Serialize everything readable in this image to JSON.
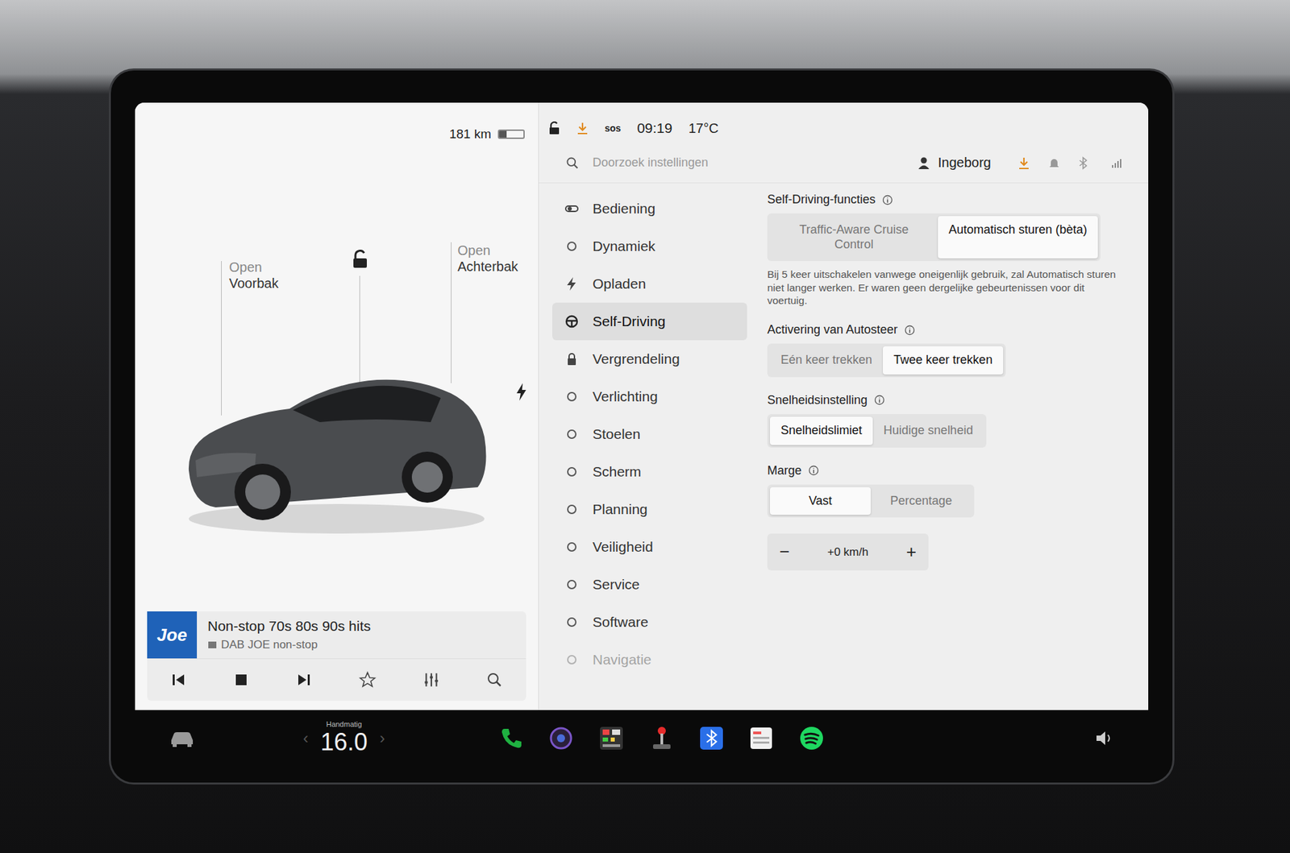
{
  "status": {
    "range": "181 km",
    "battery_level": 0.3,
    "locked": false,
    "sos": "sos",
    "time": "09:19",
    "temperature": "17°C"
  },
  "car": {
    "locked": false,
    "charging": true,
    "front_trunk": {
      "action": "Open",
      "name": "Voorbak"
    },
    "rear_trunk": {
      "action": "Open",
      "name": "Achterbak"
    }
  },
  "media": {
    "logo": "Joe",
    "title": "Non-stop 70s 80s 90s hits",
    "subtitle": "DAB JOE non-stop",
    "playing": true
  },
  "search": {
    "placeholder": "Doorzoek instellingen"
  },
  "profile": {
    "name": "Ingeborg"
  },
  "menu": [
    {
      "label": "Bediening",
      "selected": false,
      "faded": false
    },
    {
      "label": "Dynamiek",
      "selected": false,
      "faded": false
    },
    {
      "label": "Opladen",
      "selected": false,
      "faded": false
    },
    {
      "label": "Self-Driving",
      "selected": true,
      "faded": false
    },
    {
      "label": "Vergrendeling",
      "selected": false,
      "faded": false
    },
    {
      "label": "Verlichting",
      "selected": false,
      "faded": false
    },
    {
      "label": "Stoelen",
      "selected": false,
      "faded": false
    },
    {
      "label": "Scherm",
      "selected": false,
      "faded": false
    },
    {
      "label": "Planning",
      "selected": false,
      "faded": false
    },
    {
      "label": "Veiligheid",
      "selected": false,
      "faded": false
    },
    {
      "label": "Service",
      "selected": false,
      "faded": false
    },
    {
      "label": "Software",
      "selected": false,
      "faded": false
    },
    {
      "label": "Navigatie",
      "selected": false,
      "faded": true
    }
  ],
  "settings": [
    {
      "kind": "segmented",
      "title": "Self-Driving-functies",
      "options": [
        {
          "label": "Traffic-Aware Cruise Control",
          "selected": false
        },
        {
          "label": "Automatisch sturen (bèta)",
          "selected": true
        }
      ],
      "note": "Bij 5 keer uitschakelen vanwege oneigenlijk gebruik, zal Automatisch sturen niet langer werken. Er waren geen dergelijke gebeurtenissen voor dit voertuig."
    },
    {
      "kind": "segmented",
      "title": "Activering van Autosteer",
      "options": [
        {
          "label": "Eén keer trekken",
          "selected": false
        },
        {
          "label": "Twee keer trekken",
          "selected": true
        }
      ],
      "note": ""
    },
    {
      "kind": "segmented",
      "title": "Snelheidsinstelling",
      "options": [
        {
          "label": "Snelheidslimiet",
          "selected": true
        },
        {
          "label": "Huidige snelheid",
          "selected": false
        }
      ],
      "note": ""
    },
    {
      "kind": "segmented",
      "title": "Marge",
      "options": [
        {
          "label": "Vast",
          "selected": true
        },
        {
          "label": "Percentage",
          "selected": false
        }
      ],
      "note": ""
    },
    {
      "kind": "stepper",
      "minus": "−",
      "value": "+0 km/h",
      "plus": "+"
    }
  ],
  "dock": {
    "climate_label": "Handmatig",
    "temperature": "16.0",
    "prev": "‹",
    "next": "›"
  }
}
